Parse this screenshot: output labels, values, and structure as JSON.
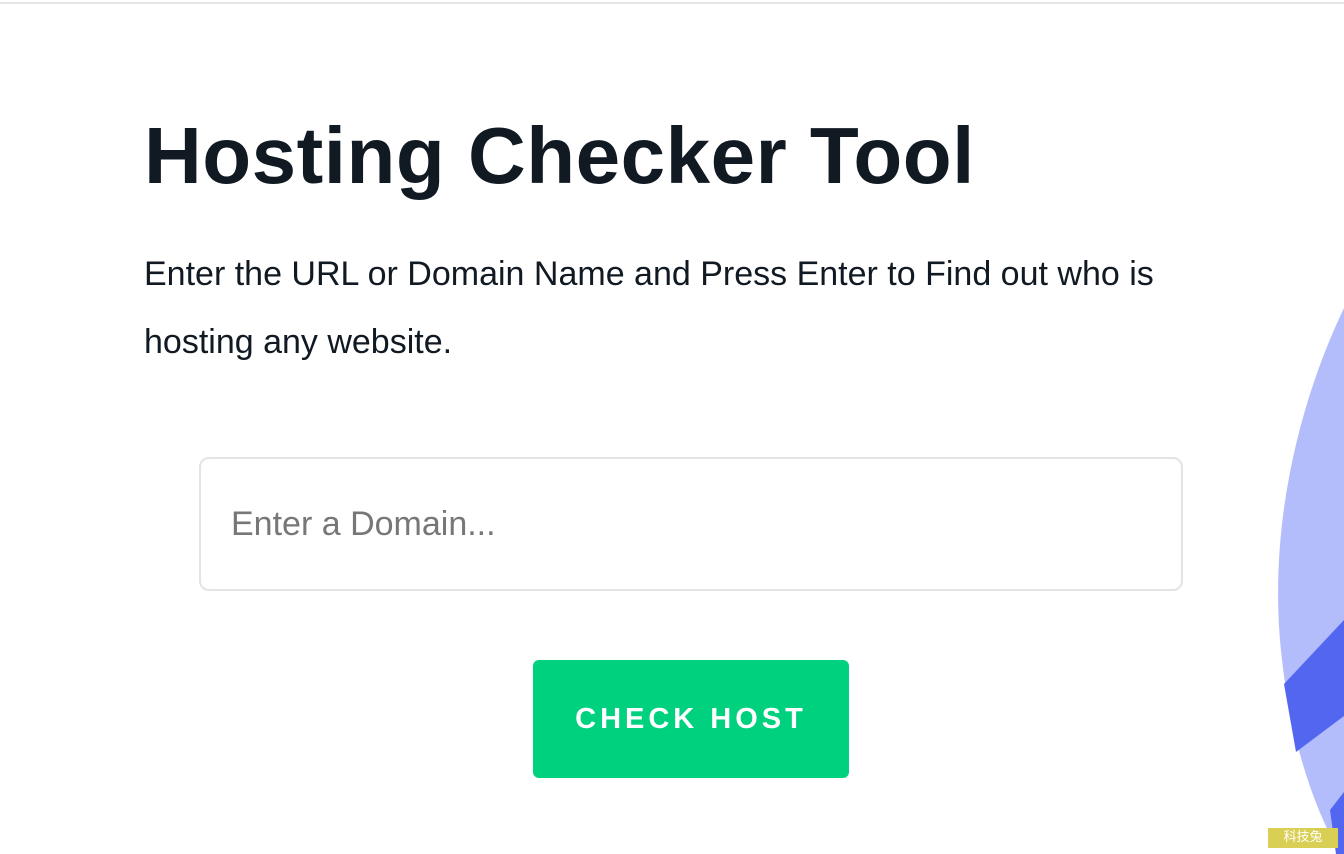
{
  "header": {
    "title": "Hosting Checker Tool",
    "description": "Enter the URL or Domain Name and Press Enter to Find out who is hosting any website."
  },
  "search": {
    "value": "",
    "placeholder": "Enter a Domain..."
  },
  "actions": {
    "check_label": "CHECK HOST"
  },
  "watermark": {
    "text": "科技兔"
  },
  "colors": {
    "title_text": "#111a22",
    "button_bg": "#00d17f",
    "button_text": "#ffffff",
    "deco_light": "#b3bdfb",
    "deco_dark": "#5366f0"
  }
}
